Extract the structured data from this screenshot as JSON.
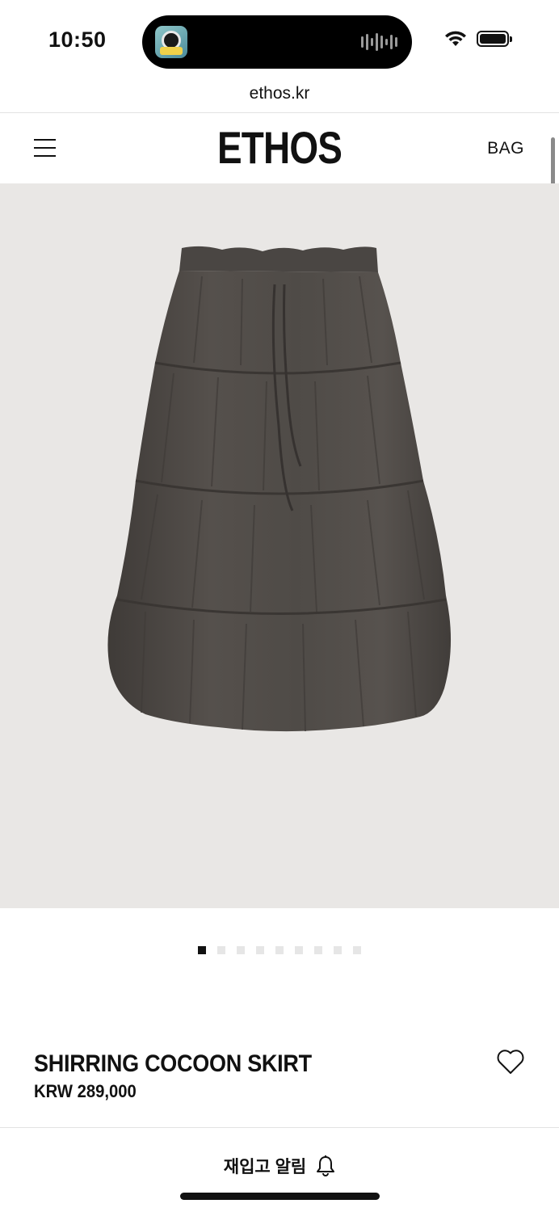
{
  "status_bar": {
    "time": "10:50",
    "icons": [
      "app-activity-icon",
      "audio-waveform-icon",
      "wifi-icon",
      "battery-icon"
    ]
  },
  "browser": {
    "url": "ethos.kr"
  },
  "header": {
    "logo": "ETHOS",
    "bag_label": "BAG",
    "menu_icon": "hamburger-menu-icon"
  },
  "product": {
    "name": "SHIRRING COCOON SKIRT",
    "price": "KRW 289,000",
    "image_count": 9,
    "active_image_index": 0,
    "image_description_color": "#4e4a46"
  },
  "actions": {
    "restock_label": "재입고 알림",
    "restock_icon": "bell-icon",
    "wishlist_icon": "heart-icon"
  },
  "colors": {
    "image_background": "#e9e7e5",
    "text": "#111111",
    "inactive_dot": "#e6e6e6"
  }
}
